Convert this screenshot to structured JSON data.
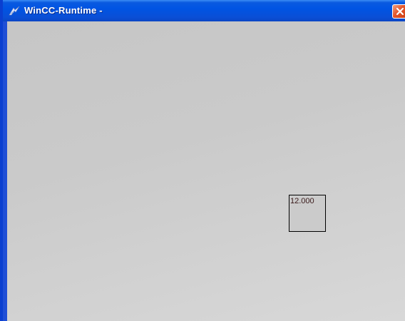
{
  "window": {
    "title": "WinCC-Runtime -",
    "title_icon": "wincc-app-icon",
    "close_icon": "close-icon"
  },
  "io_field": {
    "value": "12.000"
  },
  "colors": {
    "titlebar": "#0054e3",
    "client_background": "#cccccc",
    "close_button": "#e4552a"
  }
}
